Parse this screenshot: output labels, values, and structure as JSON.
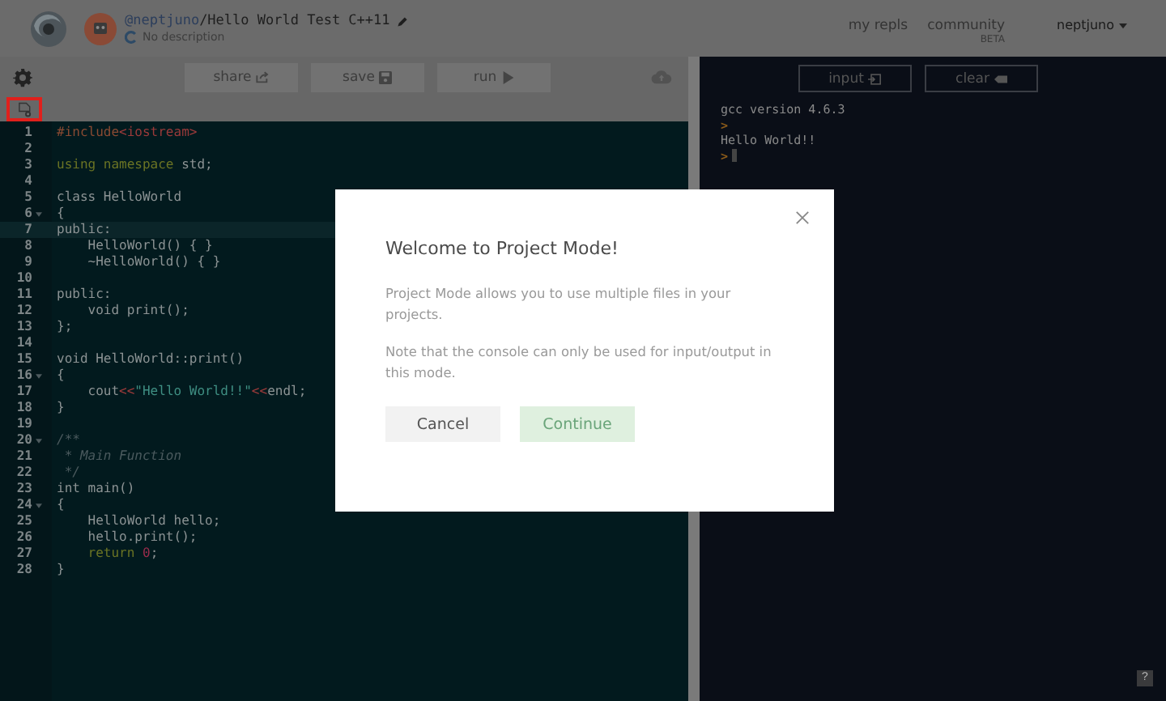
{
  "header": {
    "user": "@neptjuno",
    "repl_title": "/Hello World Test C++11",
    "description": "No description",
    "nav": [
      {
        "label": "my repls"
      },
      {
        "label": "community",
        "badge": "BETA"
      }
    ],
    "account": "neptjuno"
  },
  "toolbar": {
    "buttons": [
      {
        "label": "share",
        "kind": "share"
      },
      {
        "label": "save",
        "kind": "save"
      },
      {
        "label": "run",
        "kind": "run"
      }
    ],
    "file_button_highlighted": true
  },
  "editor": {
    "lines": [
      {
        "number": "1",
        "foldable": false,
        "active": false,
        "tokens": [
          {
            "kind": "preproc",
            "text": "#include"
          },
          {
            "kind": "string2",
            "text": "<iostream>"
          }
        ]
      },
      {
        "number": "2",
        "foldable": false,
        "active": false
      },
      {
        "number": "3",
        "foldable": false,
        "active": false,
        "tokens": [
          {
            "kind": "keyword",
            "text": "using namespace"
          },
          {
            "kind": "plain",
            "text": " std;"
          }
        ]
      },
      {
        "number": "4",
        "foldable": false,
        "active": false
      },
      {
        "number": "5",
        "foldable": false,
        "active": false,
        "tokens": [
          {
            "kind": "plain",
            "text": "class HelloWorld"
          }
        ]
      },
      {
        "number": "6",
        "foldable": true,
        "active": false,
        "tokens": [
          {
            "kind": "plain",
            "text": "{"
          }
        ]
      },
      {
        "number": "7",
        "foldable": false,
        "active": true,
        "tokens": [
          {
            "kind": "plain",
            "text": "public:"
          }
        ]
      },
      {
        "number": "8",
        "foldable": false,
        "active": false,
        "tokens": [
          {
            "kind": "plain",
            "text": "    HelloWorld() { }"
          }
        ]
      },
      {
        "number": "9",
        "foldable": false,
        "active": false,
        "tokens": [
          {
            "kind": "plain",
            "text": "    ~HelloWorld() { }"
          }
        ]
      },
      {
        "number": "10",
        "foldable": false,
        "active": false
      },
      {
        "number": "11",
        "foldable": false,
        "active": false,
        "tokens": [
          {
            "kind": "plain",
            "text": "public:"
          }
        ]
      },
      {
        "number": "12",
        "foldable": false,
        "active": false,
        "tokens": [
          {
            "kind": "plain",
            "text": "    void print();"
          }
        ]
      },
      {
        "number": "13",
        "foldable": false,
        "active": false,
        "tokens": [
          {
            "kind": "plain",
            "text": "};"
          }
        ]
      },
      {
        "number": "14",
        "foldable": false,
        "active": false
      },
      {
        "number": "15",
        "foldable": false,
        "active": false,
        "tokens": [
          {
            "kind": "plain",
            "text": "void HelloWorld::print()"
          }
        ]
      },
      {
        "number": "16",
        "foldable": true,
        "active": false,
        "tokens": [
          {
            "kind": "plain",
            "text": "{"
          }
        ]
      },
      {
        "number": "17",
        "foldable": false,
        "active": false,
        "tokens": [
          {
            "kind": "plain",
            "text": "    cout"
          },
          {
            "kind": "operator",
            "text": "<<"
          },
          {
            "kind": "string",
            "text": "\"Hello World!!\""
          },
          {
            "kind": "operator",
            "text": "<<"
          },
          {
            "kind": "plain",
            "text": "endl;"
          }
        ]
      },
      {
        "number": "18",
        "foldable": false,
        "active": false,
        "tokens": [
          {
            "kind": "plain",
            "text": "}"
          }
        ]
      },
      {
        "number": "19",
        "foldable": false,
        "active": false
      },
      {
        "number": "20",
        "foldable": true,
        "active": false,
        "tokens": [
          {
            "kind": "comment",
            "text": "/**"
          }
        ]
      },
      {
        "number": "21",
        "foldable": false,
        "active": false,
        "tokens": [
          {
            "kind": "comment",
            "text": " * Main Function"
          }
        ]
      },
      {
        "number": "22",
        "foldable": false,
        "active": false,
        "tokens": [
          {
            "kind": "comment",
            "text": " */"
          }
        ]
      },
      {
        "number": "23",
        "foldable": false,
        "active": false,
        "tokens": [
          {
            "kind": "plain",
            "text": "int main()"
          }
        ]
      },
      {
        "number": "24",
        "foldable": true,
        "active": false,
        "tokens": [
          {
            "kind": "plain",
            "text": "{"
          }
        ]
      },
      {
        "number": "25",
        "foldable": false,
        "active": false,
        "tokens": [
          {
            "kind": "plain",
            "text": "    HelloWorld hello;"
          }
        ]
      },
      {
        "number": "26",
        "foldable": false,
        "active": false,
        "tokens": [
          {
            "kind": "plain",
            "text": "    hello.print();"
          }
        ]
      },
      {
        "number": "27",
        "foldable": false,
        "active": false,
        "tokens": [
          {
            "kind": "keyword",
            "text": "    return"
          },
          {
            "kind": "number",
            "text": " 0"
          },
          {
            "kind": "plain",
            "text": ";"
          }
        ]
      },
      {
        "number": "28",
        "foldable": false,
        "active": false,
        "tokens": [
          {
            "kind": "plain",
            "text": "}"
          }
        ]
      }
    ]
  },
  "console": {
    "buttons": [
      {
        "label": "input",
        "kind": "input"
      },
      {
        "label": "clear",
        "kind": "clear"
      }
    ],
    "lines": [
      {
        "kind": "output",
        "text": "gcc version 4.6.3"
      },
      {
        "kind": "prompt",
        "text": ">"
      },
      {
        "kind": "output",
        "text": "Hello World!!"
      },
      {
        "kind": "prompt",
        "text": ">",
        "cursor": true
      }
    ],
    "help": "?"
  },
  "modal": {
    "title": "Welcome to Project Mode!",
    "paragraphs": [
      "Project Mode allows you to use multiple files in your projects.",
      "Note that the console can only be used for input/output in this mode."
    ],
    "cancel": "Cancel",
    "continue": "Continue"
  }
}
